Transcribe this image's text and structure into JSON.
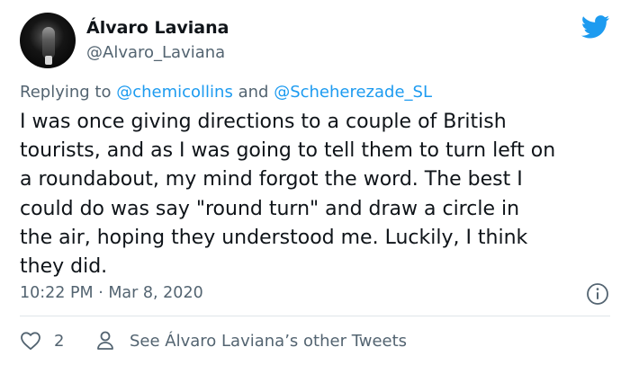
{
  "author": {
    "display_name": "Álvaro Laviana",
    "handle": "@Alvaro_Laviana"
  },
  "reply": {
    "prefix": "Replying to",
    "mention_1": "@chemicollins",
    "joiner": "and",
    "mention_2": "@Scheherezade_SL"
  },
  "tweet": {
    "text": "I was once giving directions to a couple of British\ntourists, and as I was going to tell them to turn left on\na roundabout, my mind forgot the word. The best I\ncould do was say \"round turn\" and draw a circle in\nthe air, hoping they understood me. Luckily, I think\nthey did.",
    "timestamp": "10:22 PM · Mar 8, 2020"
  },
  "actions": {
    "like_count": "2",
    "other_tweets_label": "See Álvaro Laviana’s other Tweets"
  },
  "icons": {
    "brand": "twitter-bird-icon",
    "info": "info-icon",
    "like": "heart-icon",
    "profile": "person-icon"
  },
  "colors": {
    "brand_blue": "#1d9bf0",
    "text_primary": "#0f1419",
    "text_secondary": "#536471",
    "divider": "#dfe5e9"
  }
}
